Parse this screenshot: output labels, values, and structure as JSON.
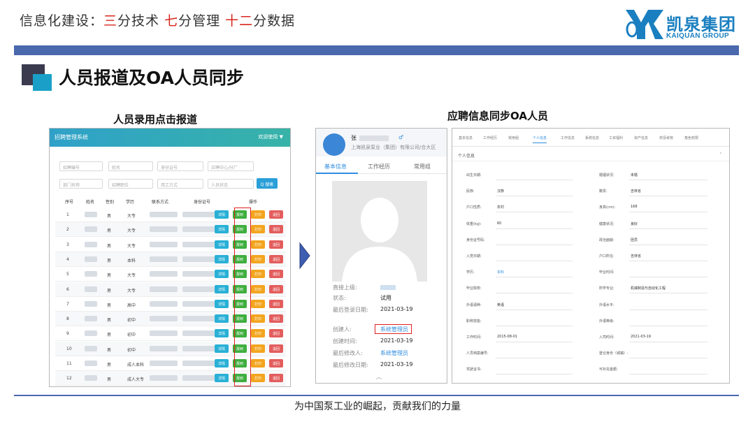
{
  "header": {
    "prefix": "信息化建设：",
    "n1": "三",
    "t1": "分技术 ",
    "n2": "七",
    "t2": "分管理 ",
    "n3": "十二",
    "t3": "分数据"
  },
  "logo": {
    "cn": "凯泉集团",
    "en": "KAIQUAN GROUP"
  },
  "slide_title": "人员报道及OA人员同步",
  "left_caption": "人员录用点击报道",
  "right_caption": "应聘信息同步OA人员",
  "footer": "为中国泵工业的崛起，贡献我们的力量",
  "left_app": {
    "title": "招聘管理系统",
    "user": "欢迎使用 ▼",
    "filters": [
      "招聘编号",
      "姓名",
      "身份证号",
      "应聘中心/分厂",
      "部门名称",
      "招聘职位",
      "用工方式",
      "人员状态"
    ],
    "search_label": "Q 搜索",
    "columns": [
      "序号",
      "姓名",
      "性别",
      "学历",
      "联系方式",
      "身份证号",
      "操作"
    ],
    "actions": [
      "详情",
      "报到",
      "打印",
      "退回"
    ],
    "rows": [
      {
        "no": "1",
        "gender": "男",
        "edu": "大专"
      },
      {
        "no": "2",
        "gender": "男",
        "edu": "大专"
      },
      {
        "no": "3",
        "gender": "男",
        "edu": "大专"
      },
      {
        "no": "4",
        "gender": "男",
        "edu": "本科"
      },
      {
        "no": "5",
        "gender": "男",
        "edu": "大专"
      },
      {
        "no": "6",
        "gender": "男",
        "edu": "大专"
      },
      {
        "no": "7",
        "gender": "男",
        "edu": "高中"
      },
      {
        "no": "8",
        "gender": "男",
        "edu": "初中"
      },
      {
        "no": "9",
        "gender": "男",
        "edu": "初中"
      },
      {
        "no": "10",
        "gender": "男",
        "edu": "初中"
      },
      {
        "no": "11",
        "gender": "男",
        "edu": "成人本科"
      },
      {
        "no": "12",
        "gender": "男",
        "edu": "成人大专"
      }
    ]
  },
  "middle_app": {
    "name": "张",
    "gender_icon": "♂",
    "company": "上海凯泉泵业（集团）有限公司/合大区",
    "tabs": [
      "基本信息",
      "工作经历",
      "常用组"
    ],
    "fields": [
      {
        "k": "直接上级:",
        "v": ""
      },
      {
        "k": "状态:",
        "v": "试用"
      },
      {
        "k": "最后登录日期:",
        "v": "2021-03-19"
      },
      {
        "k": "创建人:",
        "v": "系统管理员",
        "link": true
      },
      {
        "k": "创建时间:",
        "v": "2021-03-19"
      },
      {
        "k": "最后修改人:",
        "v": "系统管理员",
        "link": true
      },
      {
        "k": "最后修改日期:",
        "v": "2021-03-19"
      }
    ]
  },
  "right_app": {
    "tabs": [
      "基本信息",
      "工作经历",
      "常用组",
      "个人信息",
      "工作信息",
      "系统信息",
      "工资福利",
      "资产信息",
      "奖惩考核",
      "角色权限"
    ],
    "active_tab": 3,
    "section": "个人信息",
    "left_fields": [
      {
        "k": "出生日期:",
        "v": ""
      },
      {
        "k": "民族:",
        "v": "汉族"
      },
      {
        "k": "户口性质:",
        "v": "农村"
      },
      {
        "k": "体重(kg):",
        "v": "60"
      },
      {
        "k": "身份证号码:",
        "v": ""
      },
      {
        "k": "入党日期:",
        "v": ""
      },
      {
        "k": "学历:",
        "v": "本科"
      },
      {
        "k": "毕业院校:",
        "v": ""
      },
      {
        "k": "外语语种:",
        "v": "英语"
      },
      {
        "k": "职称技能:",
        "v": ""
      },
      {
        "k": "工作时间:",
        "v": "2015-08-01"
      },
      {
        "k": "人员档案编号:",
        "v": ""
      },
      {
        "k": "驾驶证书:",
        "v": ""
      }
    ],
    "right_fields": [
      {
        "k": "婚姻状况:",
        "v": "未婚"
      },
      {
        "k": "籍贯:",
        "v": "吉林省"
      },
      {
        "k": "身高(cm):",
        "v": "168"
      },
      {
        "k": "健康状况:",
        "v": "良好"
      },
      {
        "k": "政治面貌:",
        "v": "团员"
      },
      {
        "k": "户口所在:",
        "v": "吉林省"
      },
      {
        "k": "毕业时间:",
        "v": ""
      },
      {
        "k": "所学专业:",
        "v": "机械制造与自动化工程"
      },
      {
        "k": "外语水平:",
        "v": ""
      },
      {
        "k": "外语等级:",
        "v": ""
      },
      {
        "k": "入司时间:",
        "v": "2021-03-19"
      },
      {
        "k": "登记身份（城镇）:",
        "v": ""
      },
      {
        "k": "可补充金额:",
        "v": ""
      }
    ]
  }
}
